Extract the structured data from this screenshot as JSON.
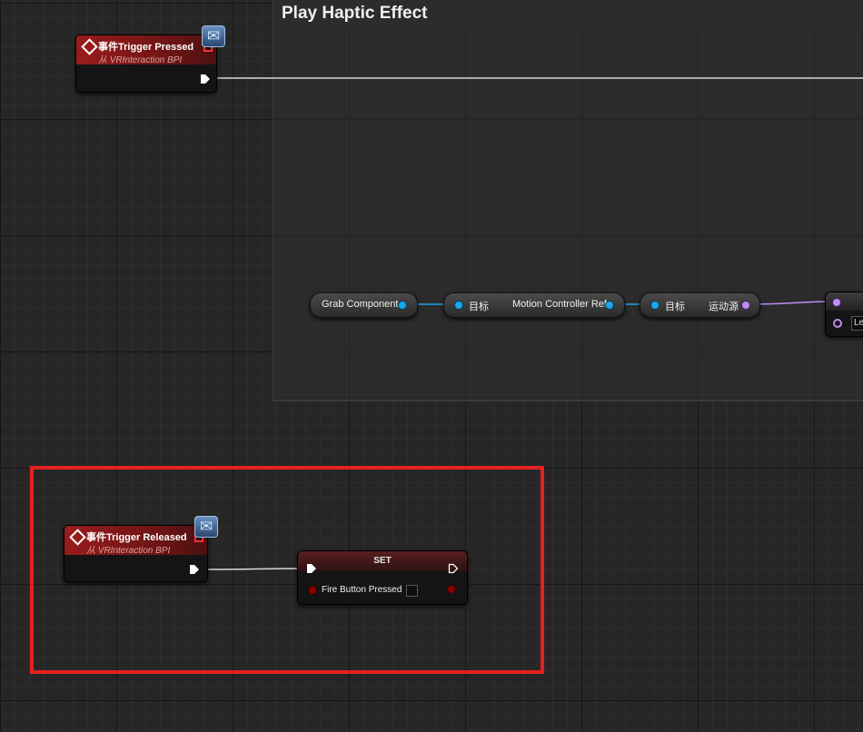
{
  "comment": {
    "title": "Play Haptic Effect"
  },
  "event_pressed": {
    "title": "事件Trigger Pressed",
    "subtitle": "从 VRInteraction BPI"
  },
  "event_released": {
    "title": "事件Trigger Released",
    "subtitle": "从 VRInteraction BPI"
  },
  "grab_component": {
    "label": "Grab Component"
  },
  "motion_controller_node": {
    "target_label": "目标",
    "output_label": "Motion Controller Ref"
  },
  "motion_source_node": {
    "target_label": "目标",
    "output_label": "运动源"
  },
  "partial_node": {
    "input_value": "Le"
  },
  "set_node": {
    "title": "SET",
    "variable_label": "Fire Button Pressed",
    "checked": false
  },
  "colors": {
    "event_header": "#9a1c1c",
    "exec_wire": "#d8d8d8",
    "object_pin": "#1aa7ec",
    "enum_pin": "#c08cf0",
    "bool_pin": "#8a0000",
    "highlight_box": "#e52020"
  },
  "icons": {
    "event": "event-diamond-icon",
    "interface": "interface-message-icon",
    "exec": "exec-arrow-icon",
    "delegate": "delegate-pin-icon"
  }
}
